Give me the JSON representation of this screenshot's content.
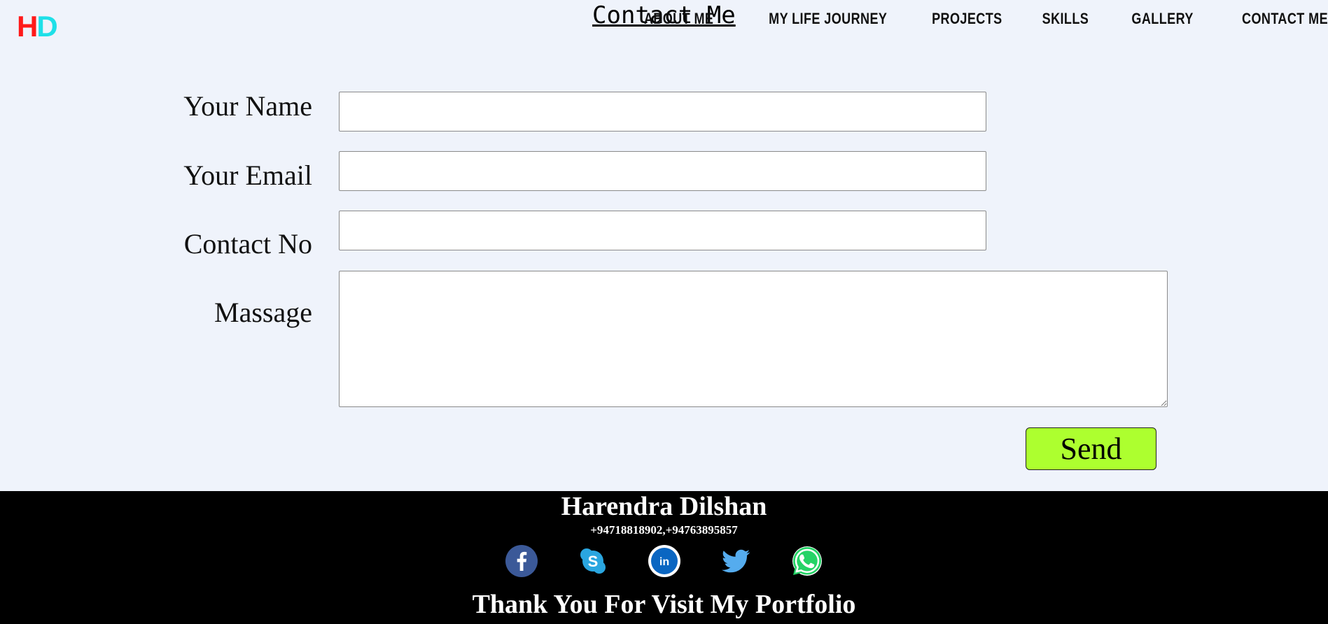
{
  "logo": {
    "h": "H",
    "d": "D"
  },
  "page_title": "Contact Me",
  "nav": [
    {
      "label": "ABOUT ME"
    },
    {
      "label": "MY LIFE JOURNEY"
    },
    {
      "label": "PROJECTS"
    },
    {
      "label": "SKILLS"
    },
    {
      "label": "GALLERY"
    },
    {
      "label": "CONTACT ME"
    }
  ],
  "form": {
    "name_label": "Your Name",
    "name_value": "",
    "email_label": "Your Email",
    "email_value": "",
    "contact_label": "Contact No",
    "contact_value": "",
    "message_label": "Massage",
    "message_value": "",
    "send_label": "Send"
  },
  "footer": {
    "name": "Harendra Dilshan",
    "phone": "+94718818902,+94763895857",
    "thanks": "Thank You For Visit My Portfolio",
    "social": [
      "facebook-icon",
      "skype-icon",
      "linkedin-icon",
      "twitter-icon",
      "whatsapp-icon"
    ]
  },
  "colors": {
    "background": "#eff3fb",
    "send_button": "#adff2f",
    "footer_bg": "#000000",
    "logo_h": "#ff1a1a",
    "logo_d": "#1ee0e8"
  }
}
